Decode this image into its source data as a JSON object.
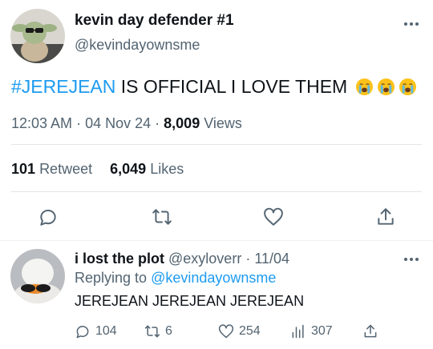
{
  "tweet": {
    "display_name": "kevin day defender #1",
    "handle": "@kevindayownsme",
    "hashtag": "#JEREJEAN",
    "text_rest": " IS OFFICIAL I LOVE THEM",
    "emoji": [
      "loudly-crying-face",
      "loudly-crying-face",
      "loudly-crying-face"
    ],
    "time": "12:03 AM",
    "date": "04 Nov 24",
    "views_count": "8,009",
    "views_label": "Views",
    "retweet_count": "101",
    "retweet_label": "Retweet",
    "likes_count": "6,049",
    "likes_label": "Likes"
  },
  "actions": [
    "reply-icon",
    "retweet-icon",
    "like-icon",
    "share-icon"
  ],
  "reply": {
    "display_name": "i lost the plot",
    "handle": "@exyloverr",
    "date": "11/04",
    "replying_prefix": "Replying to",
    "replying_to": "@kevindayownsme",
    "text": "JEREJEAN JEREJEAN JEREJEAN",
    "reply_count": "104",
    "retweet_count": "6",
    "like_count": "254",
    "view_count": "307"
  },
  "colors": {
    "link": "#1d9bf0",
    "secondary_text": "#536471",
    "divider": "#e1e6ea"
  }
}
